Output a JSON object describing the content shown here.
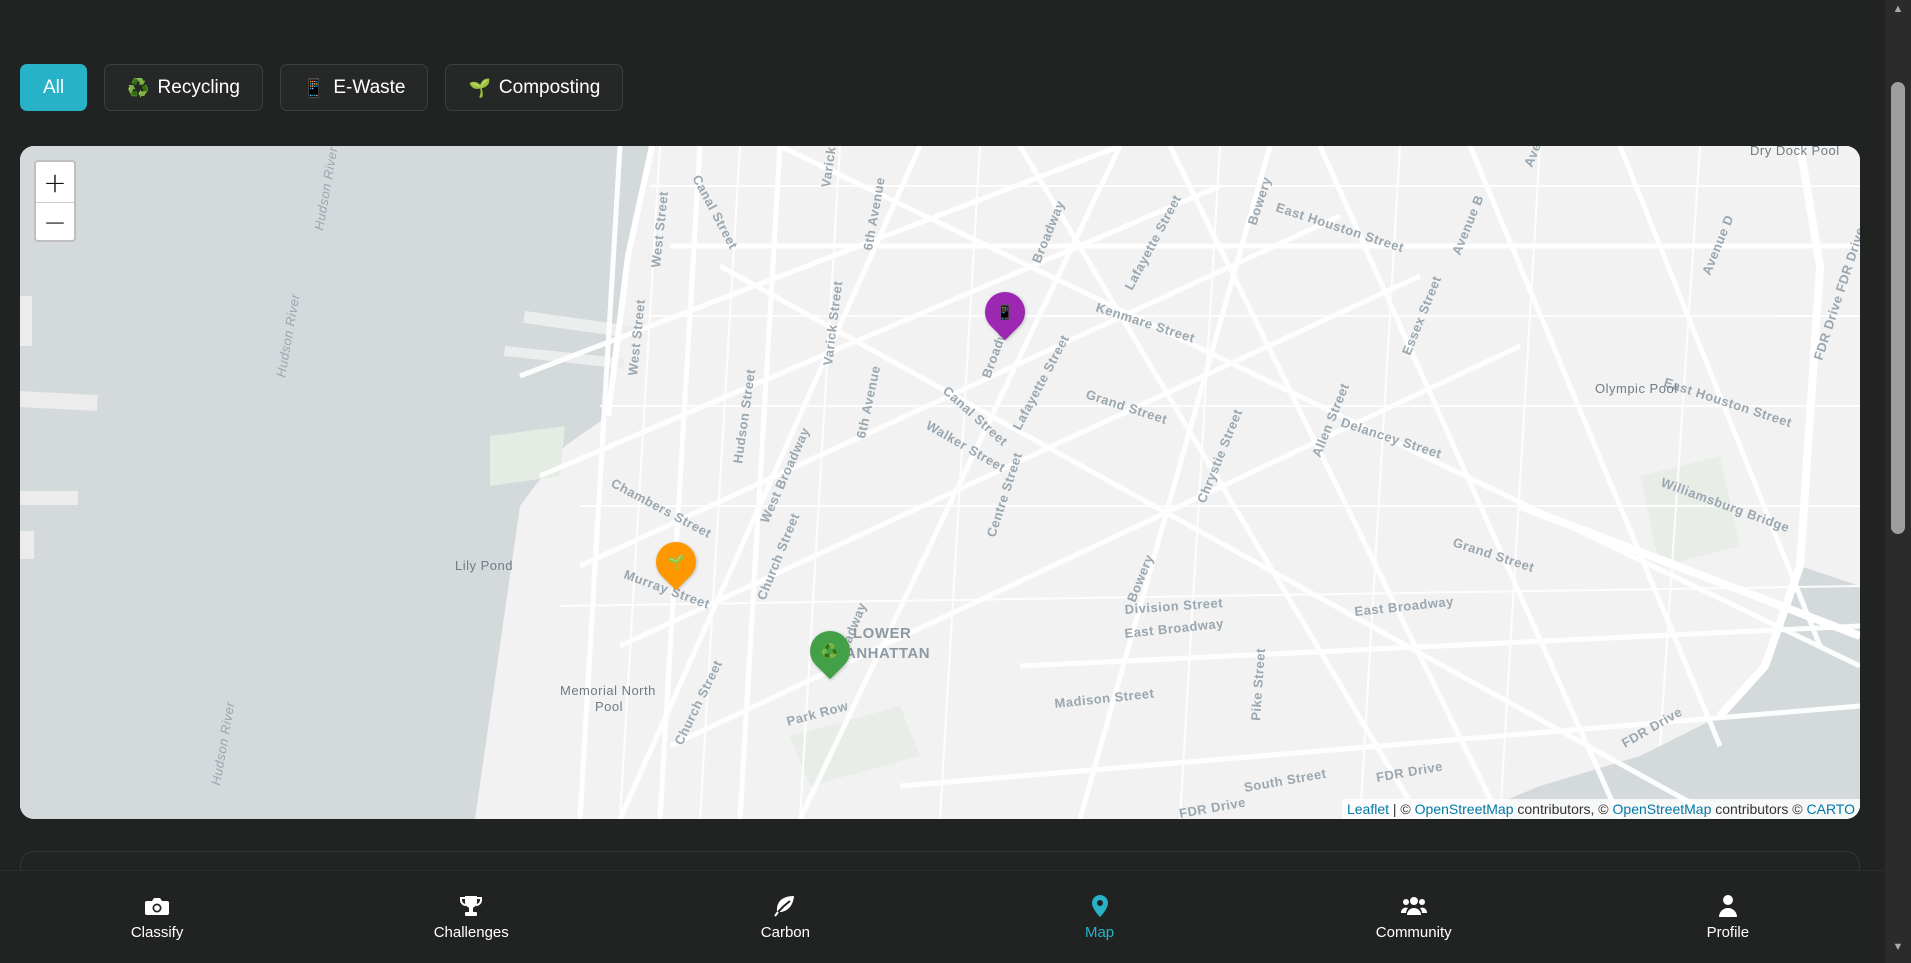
{
  "filters": [
    {
      "label": "All",
      "emoji": "",
      "active": true
    },
    {
      "label": "Recycling",
      "emoji": "♻️",
      "active": false
    },
    {
      "label": "E-Waste",
      "emoji": "📱",
      "active": false
    },
    {
      "label": "Composting",
      "emoji": "🌱",
      "active": false
    }
  ],
  "map": {
    "zoom_in": "+",
    "zoom_out": "−",
    "labels": {
      "canal1": "Canal Street",
      "canal2": "Canal Street",
      "varick1": "Varick Street",
      "varick2": "Varick Street",
      "sixth1": "6th Avenue",
      "sixth2": "6th Avenue",
      "west1": "West Street",
      "west2": "West Street",
      "hudson_river1": "Hudson River",
      "hudson_river2": "Hudson River",
      "hudson_river3": "Hudson River",
      "hudson_street": "Hudson Street",
      "broadway1": "Broadway",
      "broadway2": "Broadway",
      "broadway3": "Broadway",
      "lafayette1": "Lafayette Street",
      "lafayette2": "Lafayette Street",
      "kenmare": "Kenmare Street",
      "grand1": "Grand Street",
      "grand2": "Grand Street",
      "walker": "Walker Street",
      "centre": "Centre Street",
      "chambers": "Chambers Street",
      "murray": "Murray Street",
      "church1": "Church Street",
      "church2": "Church Street",
      "west_broadway": "West Broadway",
      "lower_manhattan1": "LOWER",
      "lower_manhattan2": "MANHATTAN",
      "park_row": "Park Row",
      "lily_pond": "Lily Pond",
      "memorial_pool1": "Memorial North",
      "memorial_pool2": "Pool",
      "bowery1": "Bowery",
      "bowery2": "Bowery",
      "east_houston1": "East Houston Street",
      "east_houston2": "East Houston Street",
      "chrystie": "Chrystie Street",
      "allen": "Allen Street",
      "essex": "Essex Street",
      "delancey": "Delancey Street",
      "division": "Division Street",
      "east_broadway1": "East Broadway",
      "east_broadway2": "East Broadway",
      "madison": "Madison Street",
      "pike": "Pike Street",
      "south": "South Street",
      "fdr1": "FDR Drive",
      "fdr2": "FDR Drive",
      "fdr3": "FDR Drive",
      "fdr4": "FDR Drive FDR Drive",
      "williamsburg": "Williamsburg Bridge",
      "olympic_pool": "Olympic Pool",
      "dry_dock": "Dry Dock Pool",
      "avenue_b": "Avenue B",
      "avenue_d": "Avenue D",
      "avenue_d2": "Avenue D",
      "avenue_a": "Ave"
    },
    "markers": [
      {
        "category": "E-Waste",
        "color": "#9c27b0",
        "glyph": "📱"
      },
      {
        "category": "Composting",
        "color": "#ff9800",
        "glyph": "🌱"
      },
      {
        "category": "Recycling",
        "color": "#43a047",
        "glyph": "♻️"
      }
    ],
    "attribution": {
      "leaflet": "Leaflet",
      "sep": " | © ",
      "osm1": "OpenStreetMap",
      "mid": " contributors, © ",
      "osm2": "OpenStreetMap",
      "end": " contributors © ",
      "carto": "CARTO"
    }
  },
  "nav": [
    {
      "label": "Classify",
      "icon": "camera-icon",
      "active": false
    },
    {
      "label": "Challenges",
      "icon": "trophy-icon",
      "active": false
    },
    {
      "label": "Carbon",
      "icon": "leaf-icon",
      "active": false
    },
    {
      "label": "Map",
      "icon": "map-pin-icon",
      "active": true
    },
    {
      "label": "Community",
      "icon": "users-icon",
      "active": false
    },
    {
      "label": "Profile",
      "icon": "user-icon",
      "active": false
    }
  ],
  "colors": {
    "background": "#212322",
    "accent": "#27b2c8",
    "water": "#d4dadc",
    "land": "#f2f2f2"
  }
}
